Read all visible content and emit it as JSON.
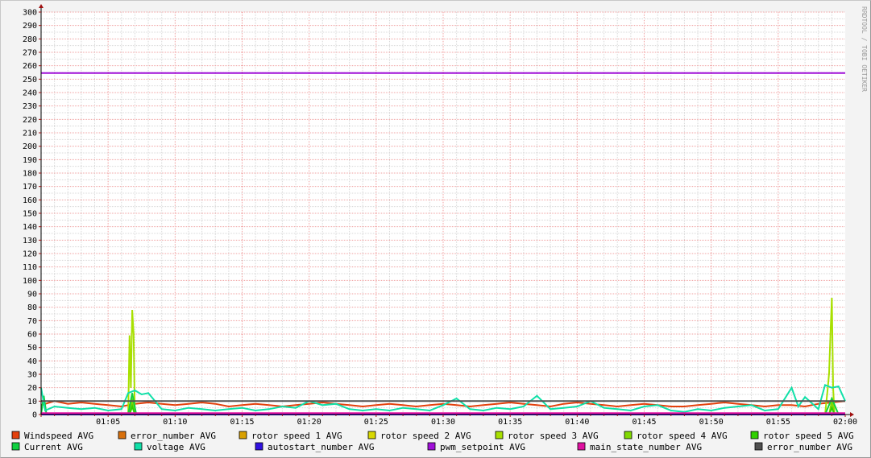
{
  "chart_data": {
    "type": "line",
    "title": "",
    "watermark": "RRDTOOL / TOBI OETIKER",
    "xlabel": "",
    "ylabel": "",
    "ylim": [
      0,
      300
    ],
    "y_ticks": [
      0,
      10,
      20,
      30,
      40,
      50,
      60,
      70,
      80,
      90,
      100,
      110,
      120,
      130,
      140,
      150,
      160,
      170,
      180,
      190,
      200,
      210,
      220,
      230,
      240,
      250,
      260,
      270,
      280,
      290,
      300
    ],
    "xlim_minutes": [
      0,
      60
    ],
    "x_ticks": [
      {
        "minute": 5,
        "label": "01:05"
      },
      {
        "minute": 10,
        "label": "01:10"
      },
      {
        "minute": 15,
        "label": "01:15"
      },
      {
        "minute": 20,
        "label": "01:20"
      },
      {
        "minute": 25,
        "label": "01:25"
      },
      {
        "minute": 30,
        "label": "01:30"
      },
      {
        "minute": 35,
        "label": "01:35"
      },
      {
        "minute": 40,
        "label": "01:40"
      },
      {
        "minute": 45,
        "label": "01:45"
      },
      {
        "minute": 50,
        "label": "01:50"
      },
      {
        "minute": 55,
        "label": "01:55"
      },
      {
        "minute": 60,
        "label": "02:00"
      }
    ],
    "grid": true,
    "legend_position": "bottom",
    "series": [
      {
        "name": "Windspeed AVG",
        "color": "#e4400c",
        "x": [
          0,
          1,
          2,
          3,
          4,
          5,
          6,
          7,
          8,
          9,
          10,
          11,
          12,
          13,
          14,
          15,
          16,
          17,
          18,
          19,
          20,
          21,
          22,
          23,
          24,
          25,
          26,
          27,
          28,
          29,
          30,
          31,
          32,
          33,
          34,
          35,
          36,
          37,
          38,
          39,
          40,
          41,
          42,
          43,
          44,
          45,
          46,
          47,
          48,
          49,
          50,
          51,
          52,
          53,
          54,
          55,
          56,
          57,
          58,
          59,
          60
        ],
        "values": [
          7,
          10,
          8,
          9,
          8,
          7,
          6,
          8,
          9,
          8,
          7,
          8,
          9,
          8,
          6,
          7,
          8,
          7,
          6,
          7,
          8,
          9,
          8,
          7,
          6,
          7,
          8,
          7,
          6,
          7,
          8,
          7,
          6,
          7,
          8,
          9,
          8,
          7,
          6,
          8,
          9,
          8,
          7,
          6,
          7,
          8,
          7,
          6,
          6,
          7,
          8,
          9,
          8,
          7,
          6,
          7,
          7,
          6,
          8,
          9,
          10
        ]
      },
      {
        "name": "error_number AVG",
        "color": "#d8700c",
        "x": [
          0,
          60
        ],
        "values": [
          0,
          0
        ]
      },
      {
        "name": "rotor speed 1 AVG",
        "color": "#d8a000",
        "x": [
          0,
          60
        ],
        "values": [
          0,
          0
        ]
      },
      {
        "name": "rotor speed 2 AVG",
        "color": "#d8d800",
        "x": [
          0,
          60
        ],
        "values": [
          0,
          0
        ]
      },
      {
        "name": "rotor speed 3 AVG",
        "color": "#a8e000",
        "x": [
          0,
          6.5,
          6.6,
          6.7,
          6.8,
          6.9,
          7.0,
          58.5,
          58.7,
          58.8,
          58.9,
          59.0,
          59.1,
          59.2,
          60
        ],
        "values": [
          0,
          0,
          59,
          20,
          78,
          60,
          0,
          0,
          20,
          31,
          60,
          87,
          20,
          0,
          0
        ]
      },
      {
        "name": "rotor speed 4 AVG",
        "color": "#80d800",
        "x": [
          0,
          6.6,
          6.8,
          7.0,
          58.8,
          59.0,
          59.2,
          60
        ],
        "values": [
          0,
          0,
          12,
          0,
          0,
          10,
          0,
          0
        ]
      },
      {
        "name": "rotor speed 5 AVG",
        "color": "#30d000",
        "x": [
          0,
          6.6,
          6.8,
          7.0,
          58.8,
          59.0,
          59.2,
          60
        ],
        "values": [
          0,
          0,
          6,
          0,
          0,
          5,
          0,
          0
        ]
      },
      {
        "name": "Current AVG",
        "color": "#10d040",
        "x": [
          0,
          0.2,
          0.4,
          6.5,
          6.8,
          7.1,
          58.5,
          59,
          59.5,
          60
        ],
        "values": [
          0,
          14,
          0,
          0,
          16,
          0,
          0,
          12,
          0,
          0
        ]
      },
      {
        "name": "voltage AVG",
        "color": "#10e0a8",
        "x": [
          0,
          0.3,
          1,
          2,
          3,
          4,
          5,
          6,
          6.5,
          7,
          7.5,
          8,
          9,
          10,
          11,
          12,
          13,
          14,
          15,
          16,
          17,
          18,
          19,
          20,
          21,
          22,
          23,
          24,
          25,
          26,
          27,
          28,
          29,
          30,
          31,
          32,
          33,
          34,
          35,
          36,
          37,
          38,
          39,
          40,
          41,
          42,
          43,
          44,
          45,
          46,
          47,
          48,
          49,
          50,
          51,
          52,
          53,
          54,
          55,
          56,
          56.5,
          57,
          58,
          58.5,
          59,
          59.5,
          60
        ],
        "values": [
          20,
          3,
          6,
          5,
          4,
          5,
          3,
          4,
          16,
          18,
          15,
          16,
          4,
          3,
          5,
          4,
          3,
          4,
          5,
          3,
          4,
          6,
          5,
          10,
          7,
          8,
          4,
          3,
          4,
          3,
          5,
          4,
          3,
          7,
          12,
          4,
          3,
          5,
          4,
          6,
          14,
          4,
          5,
          6,
          10,
          5,
          4,
          3,
          6,
          7,
          3,
          2,
          4,
          3,
          5,
          6,
          7,
          3,
          4,
          20,
          6,
          13,
          4,
          22,
          20,
          21,
          10
        ]
      },
      {
        "name": "autostart_number AVG",
        "color": "#3010e0",
        "x": [
          0,
          60
        ],
        "values": [
          0,
          0
        ]
      },
      {
        "name": "pwm_setpoint AVG",
        "color": "#a010d8",
        "x": [
          0,
          60
        ],
        "values": [
          254.5,
          254.5
        ]
      },
      {
        "name": "main_state_number AVG",
        "color": "#e010a0",
        "x": [
          0,
          60
        ],
        "values": [
          1,
          1
        ]
      },
      {
        "name": "error_number AVG",
        "color": "#505050",
        "x": [
          0,
          60
        ],
        "values": [
          10,
          10
        ]
      }
    ]
  }
}
